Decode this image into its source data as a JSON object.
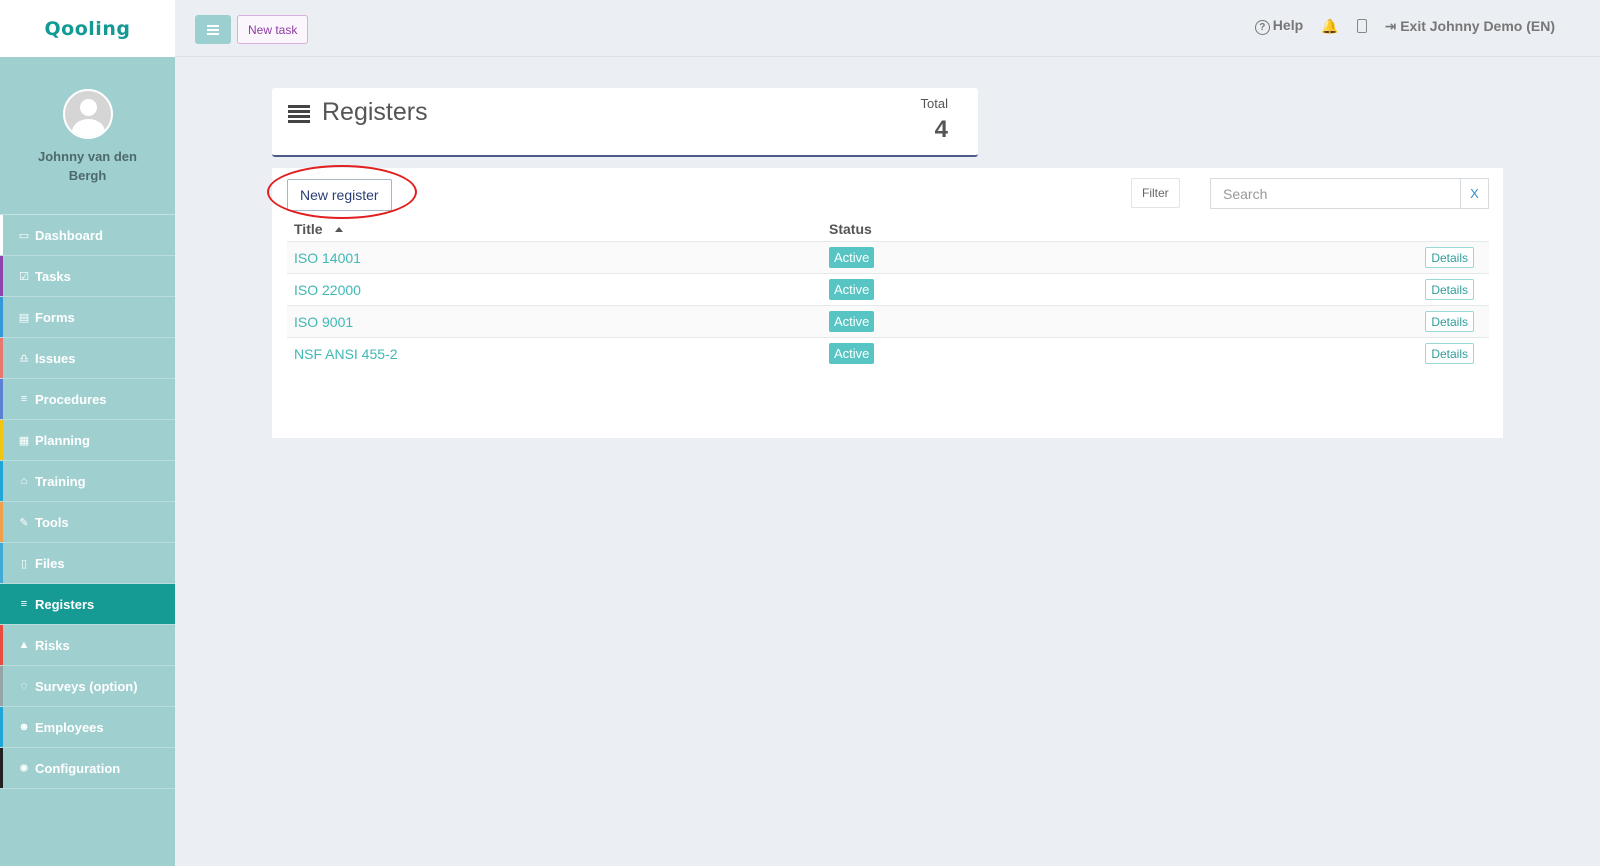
{
  "app": {
    "logo": "Qooling"
  },
  "user": {
    "name": "Johnny van den Bergh"
  },
  "sidebar": {
    "items": [
      {
        "label": "Dashboard",
        "icon": "monitor-icon",
        "color": "#ffffff",
        "active": false
      },
      {
        "label": "Tasks",
        "icon": "checkbox-icon",
        "color": "#8e44ad",
        "active": false
      },
      {
        "label": "Forms",
        "icon": "document-icon",
        "color": "#3498db",
        "active": false
      },
      {
        "label": "Issues",
        "icon": "bell-icon",
        "color": "#e8786e",
        "active": false
      },
      {
        "label": "Procedures",
        "icon": "list-icon",
        "color": "#5b7fd1",
        "active": false
      },
      {
        "label": "Planning",
        "icon": "calendar-icon",
        "color": "#f1c40f",
        "active": false
      },
      {
        "label": "Training",
        "icon": "graduation-cap-icon",
        "color": "#1fa6d6",
        "active": false
      },
      {
        "label": "Tools",
        "icon": "wrench-icon",
        "color": "#f0a04b",
        "active": false
      },
      {
        "label": "Files",
        "icon": "pdf-file-icon",
        "color": "#3fa9d8",
        "active": false
      },
      {
        "label": "Registers",
        "icon": "list-icon",
        "color": "#169a94",
        "active": true
      },
      {
        "label": "Risks",
        "icon": "warning-icon",
        "color": "#e74c3c",
        "active": false
      },
      {
        "label": "Surveys (option)",
        "icon": "speech-bubble-icon",
        "color": "#95a5a6",
        "active": false
      },
      {
        "label": "Employees",
        "icon": "users-icon",
        "color": "#1fa6d6",
        "active": false
      },
      {
        "label": "Configuration",
        "icon": "gear-icon",
        "color": "#222222",
        "active": false
      }
    ]
  },
  "topbar": {
    "new_task_label": "New task",
    "help_label": "Help",
    "exit_label": "Exit Johnny Demo (EN)"
  },
  "header": {
    "title": "Registers",
    "total_label": "Total",
    "total_value": "4"
  },
  "toolbar": {
    "new_register_label": "New register",
    "filter_label": "Filter",
    "search_placeholder": "Search",
    "clear_label": "X"
  },
  "table": {
    "columns": [
      "Title",
      "Status"
    ],
    "rows": [
      {
        "title": "ISO 14001",
        "status": "Active",
        "action": "Details"
      },
      {
        "title": "ISO 22000",
        "status": "Active",
        "action": "Details"
      },
      {
        "title": "ISO 9001",
        "status": "Active",
        "action": "Details"
      },
      {
        "title": "NSF ANSI 455-2",
        "status": "Active",
        "action": "Details"
      }
    ]
  }
}
